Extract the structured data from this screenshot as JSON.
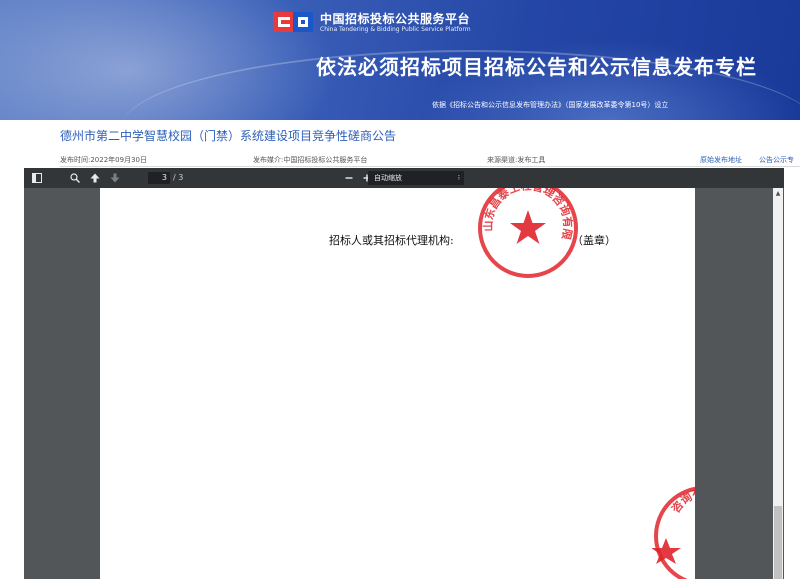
{
  "banner": {
    "logo_cn": "中国招标投标公共服务平台",
    "logo_en": "China Tendering & Bidding Public Service Platform",
    "title": "依法必须招标项目招标公告和公示信息发布专栏",
    "note": "依据《招标公告和公示信息发布管理办法》（国家发展改革委令第10号）设立"
  },
  "notice": {
    "title": "德州市第二中学智慧校园（门禁）系统建设项目竞争性磋商公告",
    "publish_time": "发布时间:2022年09月30日",
    "source_platform": "发布媒介:中国招标投标公共服务平台",
    "publisher": "来源渠道:发布工具",
    "link_original": "原始发布地址",
    "link_notice": "公告公示专"
  },
  "viewer": {
    "page_current": "3",
    "page_total": "/ 3",
    "zoom_label": "自动缩放",
    "icons": {
      "sidebar": "sidebar-toggle-icon",
      "search": "search-icon",
      "prev": "arrow-up-icon",
      "next": "arrow-down-icon",
      "zoom_out": "minus-icon",
      "zoom_in": "plus-icon"
    },
    "document": {
      "line_text": "招标人或其招标代理机构:",
      "suffix_text": "（盖章）",
      "seal_1_text": "山东昌泰工程管理咨询有限公司",
      "seal_2_text": "咨询有限公司",
      "seal_color": "#e0242b"
    }
  },
  "colors": {
    "banner_blue": "#2446a6",
    "link_blue": "#2d5fb8",
    "toolbar_dark": "#323639",
    "viewer_gray": "#525659"
  }
}
